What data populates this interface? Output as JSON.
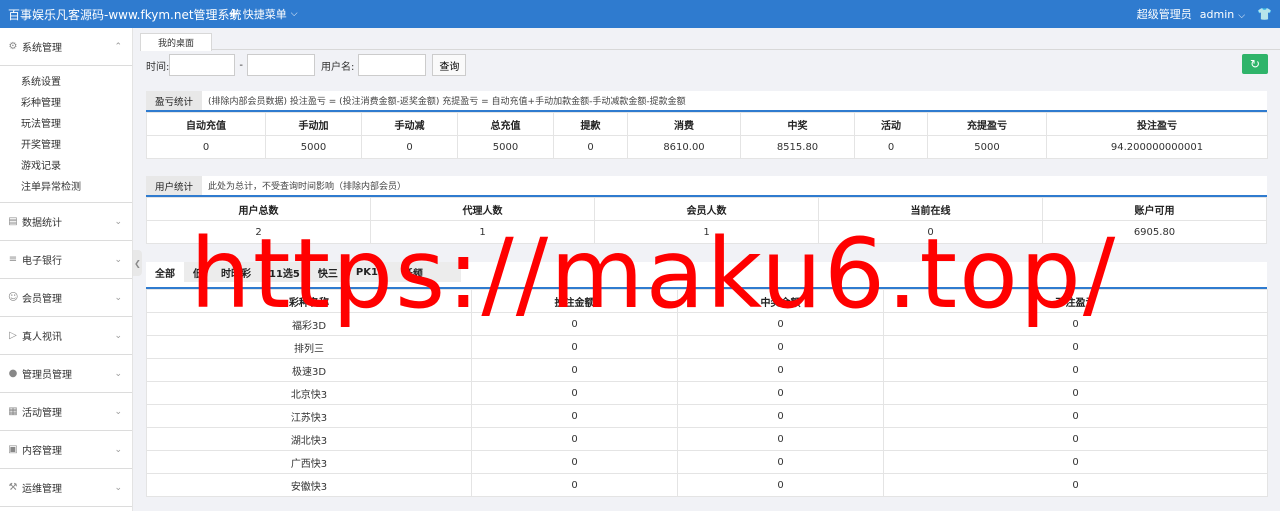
{
  "header": {
    "title": "百事娱乐凡客源码-www.fkym.net管理系统",
    "quick_menu": "快捷菜单",
    "role": "超级管理员",
    "username": "admin"
  },
  "sidebar": {
    "system_group": "系统管理",
    "system_items": [
      "系统设置",
      "彩种管理",
      "玩法管理",
      "开奖管理",
      "游戏记录",
      "注单异常检测"
    ],
    "groups": [
      "数据统计",
      "电子银行",
      "会员管理",
      "真人视讯",
      "管理员管理",
      "活动管理",
      "内容管理",
      "运维管理"
    ]
  },
  "tabs": {
    "home": "我的桌面"
  },
  "search": {
    "time_label": "时间:",
    "dash": "-",
    "username_label": "用户名:",
    "query_button": "查询"
  },
  "profit": {
    "tag": "盈亏统计",
    "note": "(排除内部会员数据)  投注盈亏 = (投注消费金额-返奖金额)    充提盈亏 = 自动充值+手动加款金额-手动减款金额-提款金额",
    "headers": [
      "自动充值",
      "手动加",
      "手动减",
      "总充值",
      "提款",
      "消费",
      "中奖",
      "活动",
      "充提盈亏",
      "投注盈亏"
    ],
    "values": [
      "0",
      "5000",
      "0",
      "5000",
      "0",
      "8610.00",
      "8515.80",
      "0",
      "5000",
      "94.200000000001"
    ]
  },
  "users": {
    "tag": "用户统计",
    "note": "此处为总计，不受查询时间影响（排除内部会员）",
    "headers": [
      "用户总数",
      "代理人数",
      "会员人数",
      "当前在线",
      "账户可用"
    ],
    "values": [
      "2",
      "1",
      "1",
      "0",
      "6905.80"
    ]
  },
  "lottery": {
    "tabs": [
      "全部",
      "低",
      "时时彩",
      "11选5",
      "快三",
      "PK10",
      "低频"
    ],
    "headers": [
      "彩种名称",
      "投注金额",
      "中奖金额",
      "下注盈亏"
    ],
    "rows": [
      [
        "福彩3D",
        "0",
        "0",
        "0"
      ],
      [
        "排列三",
        "0",
        "0",
        "0"
      ],
      [
        "极速3D",
        "0",
        "0",
        "0"
      ],
      [
        "北京快3",
        "0",
        "0",
        "0"
      ],
      [
        "江苏快3",
        "0",
        "0",
        "0"
      ],
      [
        "湖北快3",
        "0",
        "0",
        "0"
      ],
      [
        "广西快3",
        "0",
        "0",
        "0"
      ],
      [
        "安徽快3",
        "0",
        "0",
        "0"
      ]
    ]
  },
  "watermark": "https://maku6.top/",
  "colors": {
    "topbar": "#2f7bcf",
    "refresh": "#2fb46a",
    "watermark": "#ff0000"
  }
}
